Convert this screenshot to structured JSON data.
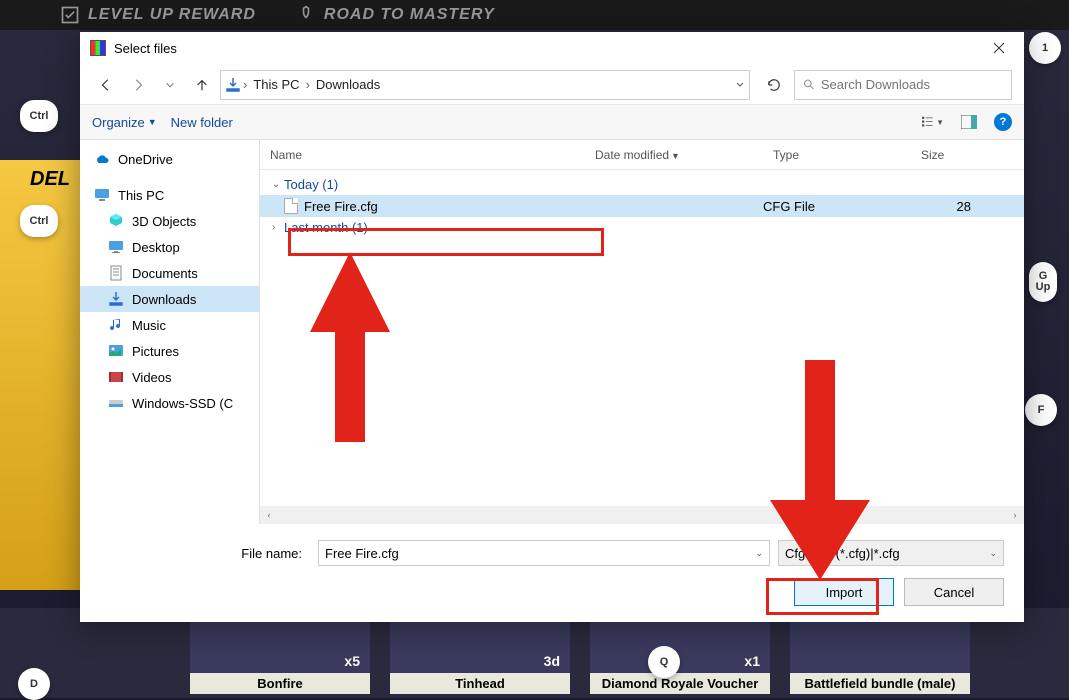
{
  "game": {
    "top_items": [
      "LEVEL UP REWARD",
      "ROAD TO MASTERY"
    ],
    "del_label": "DEL",
    "cards": [
      {
        "name": "Bonfire",
        "mult": "x5"
      },
      {
        "name": "Tinhead",
        "mult": "3d"
      },
      {
        "name": "Diamond Royale Voucher",
        "mult": "x1"
      },
      {
        "name": "Battlefield bundle (male)",
        "mult": ""
      }
    ],
    "key_hints": [
      "Ctrl",
      "Ctrl",
      "1",
      "G Up",
      "F",
      "Q",
      "D"
    ]
  },
  "dialog": {
    "title": "Select files",
    "breadcrumb": [
      "This PC",
      "Downloads"
    ],
    "search_placeholder": "Search Downloads",
    "toolbar": {
      "organize": "Organize",
      "newfolder": "New folder"
    },
    "sidebar": {
      "onedrive": "OneDrive",
      "thispc": "This PC",
      "items": [
        "3D Objects",
        "Desktop",
        "Documents",
        "Downloads",
        "Music",
        "Pictures",
        "Videos",
        "Windows-SSD (C"
      ]
    },
    "columns": {
      "name": "Name",
      "date": "Date modified",
      "type": "Type",
      "size": "Size"
    },
    "groups": [
      {
        "label": "Today (1)",
        "expanded": true,
        "files": [
          {
            "name": "Free Fire.cfg",
            "date": "",
            "type": "CFG File",
            "size": "28",
            "selected": true
          }
        ]
      },
      {
        "label": "Last month (1)",
        "expanded": false,
        "files": []
      }
    ],
    "footer": {
      "label": "File name:",
      "filename": "Free Fire.cfg",
      "filetype": "Cfg files (*.cfg)|*.cfg",
      "import": "Import",
      "cancel": "Cancel"
    }
  }
}
